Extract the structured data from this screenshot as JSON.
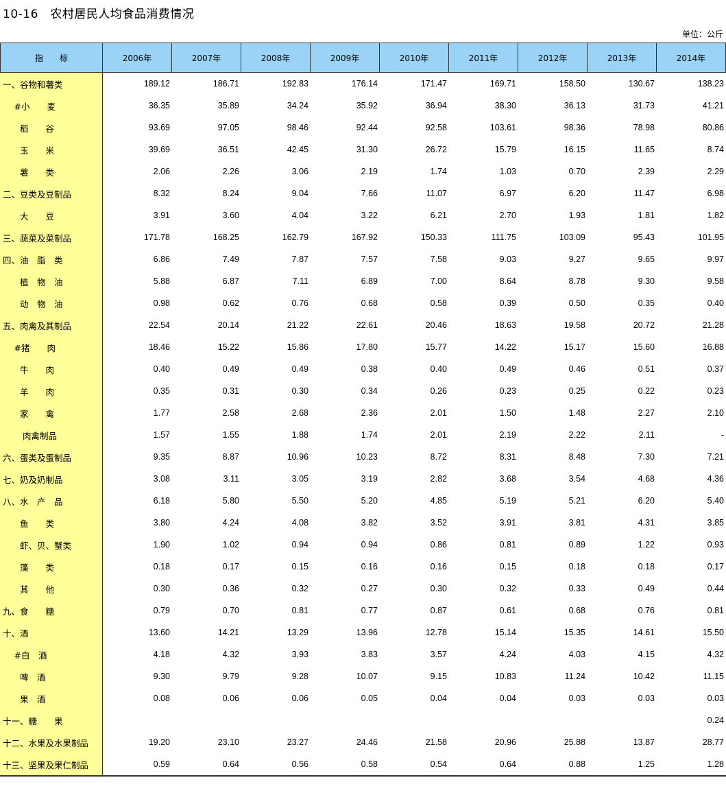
{
  "header": {
    "title": "10-16　农村居民人均食品消费情况",
    "unit": "单位：公斤"
  },
  "table": {
    "columns": [
      "指　　标",
      "2006年",
      "2007年",
      "2008年",
      "2009年",
      "2010年",
      "2011年",
      "2012年",
      "2013年",
      "2014年"
    ],
    "rows": [
      {
        "name": "一、谷物和薯类",
        "values": [
          "189.12",
          "186.71",
          "192.83",
          "176.14",
          "171.47",
          "169.71",
          "158.50",
          "130.67",
          "138.23"
        ]
      },
      {
        "name": "　 #小　　麦",
        "values": [
          "36.35",
          "35.89",
          "34.24",
          "35.92",
          "36.94",
          "38.30",
          "36.13",
          "31.73",
          "41.21"
        ]
      },
      {
        "name": "　　稻　　谷",
        "values": [
          "93.69",
          "97.05",
          "98.46",
          "92.44",
          "92.58",
          "103.61",
          "98.36",
          "78.98",
          "80.86"
        ]
      },
      {
        "name": "　　玉　　米",
        "values": [
          "39.69",
          "36.51",
          "42.45",
          "31.30",
          "26.72",
          "15.79",
          "16.15",
          "11.65",
          "8.74"
        ]
      },
      {
        "name": "　　薯　　类",
        "values": [
          "2.06",
          "2.26",
          "3.06",
          "2.19",
          "1.74",
          "1.03",
          "0.70",
          "2.39",
          "2.29"
        ]
      },
      {
        "name": "二、豆类及豆制品",
        "values": [
          "8.32",
          "8.24",
          "9.04",
          "7.66",
          "11.07",
          "6.97",
          "6.20",
          "11.47",
          "6.98"
        ]
      },
      {
        "name": "　　大　　豆",
        "values": [
          "3.91",
          "3.60",
          "4.04",
          "3.22",
          "6.21",
          "2.70",
          "1.93",
          "1.81",
          "1.82"
        ]
      },
      {
        "name": "三、蔬菜及菜制品",
        "values": [
          "171.78",
          "168.25",
          "162.79",
          "167.92",
          "150.33",
          "111.75",
          "103.09",
          "95.43",
          "101.95"
        ]
      },
      {
        "name": "四、油　脂　类",
        "values": [
          "6.86",
          "7.49",
          "7.87",
          "7.57",
          "7.58",
          "9.03",
          "9.27",
          "9.65",
          "9.97"
        ]
      },
      {
        "name": "　　植　物　油",
        "values": [
          "5.88",
          "6.87",
          "7.11",
          "6.89",
          "7.00",
          "8.64",
          "8.78",
          "9.30",
          "9.58"
        ]
      },
      {
        "name": "　　动　物　油",
        "values": [
          "0.98",
          "0.62",
          "0.76",
          "0.68",
          "0.58",
          "0.39",
          "0.50",
          "0.35",
          "0.40"
        ]
      },
      {
        "name": "五、肉禽及其制品",
        "values": [
          "22.54",
          "20.14",
          "21.22",
          "22.61",
          "20.46",
          "18.63",
          "19.58",
          "20.72",
          "21.28"
        ]
      },
      {
        "name": "　 #猪　　肉",
        "values": [
          "18.46",
          "15.22",
          "15.86",
          "17.80",
          "15.77",
          "14.22",
          "15.17",
          "15.60",
          "16.88"
        ]
      },
      {
        "name": "　　牛　　肉",
        "values": [
          "0.40",
          "0.49",
          "0.49",
          "0.38",
          "0.40",
          "0.49",
          "0.46",
          "0.51",
          "0.37"
        ]
      },
      {
        "name": "　　羊　　肉",
        "values": [
          "0.35",
          "0.31",
          "0.30",
          "0.34",
          "0.26",
          "0.23",
          "0.25",
          "0.22",
          "0.23"
        ]
      },
      {
        "name": "　　家　　禽",
        "values": [
          "1.77",
          "2.58",
          "2.68",
          "2.36",
          "2.01",
          "1.50",
          "1.48",
          "2.27",
          "2.10"
        ]
      },
      {
        "name": "　　 肉禽制品",
        "values": [
          "1.57",
          "1.55",
          "1.88",
          "1.74",
          "2.01",
          "2.19",
          "2.22",
          "2.11",
          "-"
        ]
      },
      {
        "name": "六、蛋类及蛋制品",
        "values": [
          "9.35",
          "8.87",
          "10.96",
          "10.23",
          "8.72",
          "8.31",
          "8.48",
          "7.30",
          "7.21"
        ]
      },
      {
        "name": "七、奶及奶制品",
        "values": [
          "3.08",
          "3.11",
          "3.05",
          "3.19",
          "2.82",
          "3.68",
          "3.54",
          "4.68",
          "4.36"
        ]
      },
      {
        "name": "八、水　产　品",
        "values": [
          "6.18",
          "5.80",
          "5.50",
          "5.20",
          "4.85",
          "5.19",
          "5.21",
          "6.20",
          "5.40"
        ]
      },
      {
        "name": "　　鱼　　类",
        "values": [
          "3.80",
          "4.24",
          "4.08",
          "3.82",
          "3.52",
          "3.91",
          "3.81",
          "4.31",
          "3.85"
        ]
      },
      {
        "name": "　　虾、贝、蟹类",
        "values": [
          "1.90",
          "1.02",
          "0.94",
          "0.94",
          "0.86",
          "0.81",
          "0.89",
          "1.22",
          "0.93"
        ]
      },
      {
        "name": "　　藻　　类",
        "values": [
          "0.18",
          "0.17",
          "0.15",
          "0.16",
          "0.16",
          "0.15",
          "0.18",
          "0.18",
          "0.17"
        ]
      },
      {
        "name": "　　其　　他",
        "values": [
          "0.30",
          "0.36",
          "0.32",
          "0.27",
          "0.30",
          "0.32",
          "0.33",
          "0.49",
          "0.44"
        ]
      },
      {
        "name": "九、食　　糖",
        "values": [
          "0.79",
          "0.70",
          "0.81",
          "0.77",
          "0.87",
          "0.61",
          "0.68",
          "0.76",
          "0.81"
        ]
      },
      {
        "name": "十、酒",
        "values": [
          "13.60",
          "14.21",
          "13.29",
          "13.96",
          "12.78",
          "15.14",
          "15.35",
          "14.61",
          "15.50"
        ]
      },
      {
        "name": "　 #白　酒",
        "values": [
          "4.18",
          "4.32",
          "3.93",
          "3.83",
          "3.57",
          "4.24",
          "4.03",
          "4.15",
          "4.32"
        ]
      },
      {
        "name": "　　啤　酒",
        "values": [
          "9.30",
          "9.79",
          "9.28",
          "10.07",
          "9.15",
          "10.83",
          "11.24",
          "10.42",
          "11.15"
        ]
      },
      {
        "name": "　　果　酒",
        "values": [
          "0.08",
          "0.06",
          "0.06",
          "0.05",
          "0.04",
          "0.04",
          "0.03",
          "0.03",
          "0.03"
        ]
      },
      {
        "name": "十一、糖　　果",
        "values": [
          "",
          "",
          "",
          "",
          "",
          "",
          "",
          "",
          "0.24"
        ]
      },
      {
        "name": "十二、水果及水果制品",
        "values": [
          "19.20",
          "23.10",
          "23.27",
          "24.46",
          "21.58",
          "20.96",
          "25.88",
          "13.87",
          "28.77"
        ]
      },
      {
        "name": "十三、坚果及果仁制品",
        "values": [
          "0.59",
          "0.64",
          "0.56",
          "0.58",
          "0.54",
          "0.64",
          "0.88",
          "1.25",
          "1.28"
        ]
      }
    ]
  },
  "colors": {
    "header_bg": "#9ad3f6",
    "indicator_col_bg": "#ffff99"
  }
}
